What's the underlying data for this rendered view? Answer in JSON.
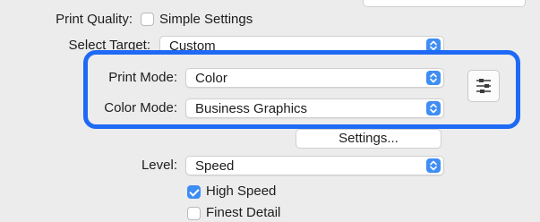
{
  "print_quality": {
    "label": "Print Quality:",
    "checkbox_label": "Simple Settings",
    "checked": false
  },
  "select_target": {
    "label": "Select Target:",
    "value": "Custom"
  },
  "print_mode": {
    "label": "Print Mode:",
    "value": "Color"
  },
  "color_mode": {
    "label": "Color Mode:",
    "value": "Business Graphics"
  },
  "settings_button": "Settings...",
  "level": {
    "label": "Level:",
    "value": "Speed"
  },
  "high_speed": {
    "label": "High Speed",
    "checked": true
  },
  "finest_detail": {
    "label": "Finest Detail",
    "checked": false
  },
  "colors": {
    "accent": "#3f8ef3",
    "highlight_border": "#1f6af5",
    "background": "#ececec"
  }
}
